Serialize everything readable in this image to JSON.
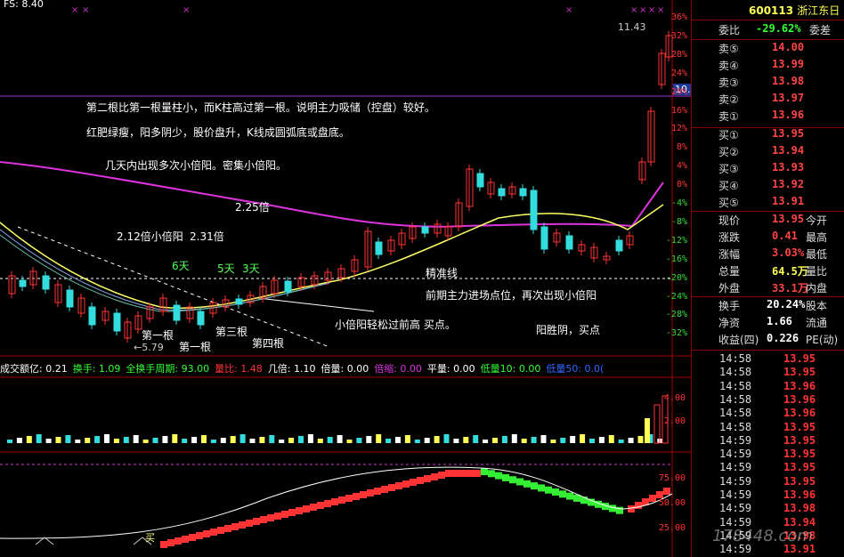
{
  "title_bar": {
    "fs_label": "FS: 8.40",
    "stock_code": "600113",
    "stock_name": "浙江东日"
  },
  "price_tags": {
    "high": "11.43",
    "current": "10.12",
    "low": "←5.79"
  },
  "pct_axis": [
    "36%",
    "32%",
    "28%",
    "24%",
    "20%",
    "16%",
    "12%",
    "8%",
    "4%",
    "0%",
    "-4%",
    "-8%",
    "-12%",
    "-16%",
    "-20%",
    "-24%",
    "-28%",
    "-32%"
  ],
  "annotations": {
    "line1": "第二根比第一根量柱小，而K柱高过第一根。说明主力吸储（控盘）较好。",
    "line2": "红肥绿瘦，阳多阴少，股价盘升，K线成圆弧底或盘底。",
    "line3": "几天内出现多次小倍阳。密集小倍阳。",
    "x225": "2.25倍",
    "x212": "2.12倍小倍阳",
    "x231": "2.31倍",
    "d6": "6天",
    "d5": "5天",
    "d3": "3天",
    "precise": "精准线",
    "prev_main": "前期主力进场点位，再次出现小倍阳",
    "small_pass": "小倍阳轻松过前高  买点。",
    "sun_neg": "阳胜阴，买点",
    "first1": "第一根",
    "first2": "第一根",
    "third": "第三根",
    "fourth": "第四根",
    "buy_mark": "买"
  },
  "indicator_bar": [
    {
      "label": "成交额亿: 0.21",
      "color": "#ffffff"
    },
    {
      "label": "换手: 1.09",
      "color": "#33ff33"
    },
    {
      "label": "全换手周期: 93.00",
      "color": "#33ff33"
    },
    {
      "label": "量比: 1.48",
      "color": "#ff3333"
    },
    {
      "label": "几倍: 1.10",
      "color": "#ffffff"
    },
    {
      "label": "倍量: 0.00",
      "color": "#ffffff"
    },
    {
      "label": "倍缩: 0.00",
      "color": "#dd33dd"
    },
    {
      "label": "平量: 0.00",
      "color": "#ffffff"
    },
    {
      "label": "低量10: 0.00",
      "color": "#33ff33"
    },
    {
      "label": "低量50: 0.0(",
      "color": "#3366ff"
    }
  ],
  "vol_axis": [
    "4.00",
    "2.00"
  ],
  "osc_axis": [
    "75.00",
    "50.00",
    "25.00"
  ],
  "quote_panel": {
    "weibi_label": "委比",
    "weibi_value": "-29.62%",
    "weicha_label": "委差",
    "sells": [
      {
        "label": "卖⑤",
        "price": "14.00"
      },
      {
        "label": "卖④",
        "price": "13.99"
      },
      {
        "label": "卖③",
        "price": "13.98"
      },
      {
        "label": "卖②",
        "price": "13.97"
      },
      {
        "label": "卖①",
        "price": "13.96"
      }
    ],
    "buys": [
      {
        "label": "买①",
        "price": "13.95"
      },
      {
        "label": "买②",
        "price": "13.94"
      },
      {
        "label": "买③",
        "price": "13.93"
      },
      {
        "label": "买④",
        "price": "13.92"
      },
      {
        "label": "买⑤",
        "price": "13.91"
      }
    ],
    "stats": [
      {
        "label": "现价",
        "value": "13.95",
        "right": "今开"
      },
      {
        "label": "涨跌",
        "value": "0.41",
        "right": "最高"
      },
      {
        "label": "涨幅",
        "value": "3.03%",
        "right": "最低"
      },
      {
        "label": "总量",
        "value": "64.5万",
        "right": "量比"
      },
      {
        "label": "外盘",
        "value": "33.1万",
        "right": "内盘"
      }
    ],
    "stats2": [
      {
        "label": "换手",
        "value": "20.24%",
        "right": "股本"
      },
      {
        "label": "净资",
        "value": "1.66",
        "right": "流通"
      },
      {
        "label": "收益(四)",
        "value": "0.226",
        "right": "PE(动)"
      }
    ],
    "ticks": [
      {
        "time": "14:58",
        "price": "13.95",
        "up": true
      },
      {
        "time": "14:58",
        "price": "13.95",
        "up": true
      },
      {
        "time": "14:58",
        "price": "13.96",
        "up": true
      },
      {
        "time": "14:58",
        "price": "13.96",
        "up": true
      },
      {
        "time": "14:58",
        "price": "13.96",
        "up": true
      },
      {
        "time": "14:58",
        "price": "13.95",
        "up": true
      },
      {
        "time": "14:59",
        "price": "13.95",
        "up": true
      },
      {
        "time": "14:59",
        "price": "13.95",
        "up": true
      },
      {
        "time": "14:59",
        "price": "13.95",
        "up": true
      },
      {
        "time": "14:59",
        "price": "13.95",
        "up": true
      },
      {
        "time": "14:59",
        "price": "13.96",
        "up": true
      },
      {
        "time": "14:59",
        "price": "13.98",
        "up": true
      },
      {
        "time": "14:59",
        "price": "13.94",
        "up": true
      },
      {
        "time": "14:59",
        "price": "13.98",
        "up": true
      },
      {
        "time": "14:59",
        "price": "13.91",
        "up": true
      }
    ]
  },
  "watermark": "178448.com",
  "colors": {
    "up": "#ff3333",
    "down": "#33dddd",
    "ma_yellow": "#ffff66",
    "ma_purple": "#dd33dd",
    "bg": "#000000"
  }
}
